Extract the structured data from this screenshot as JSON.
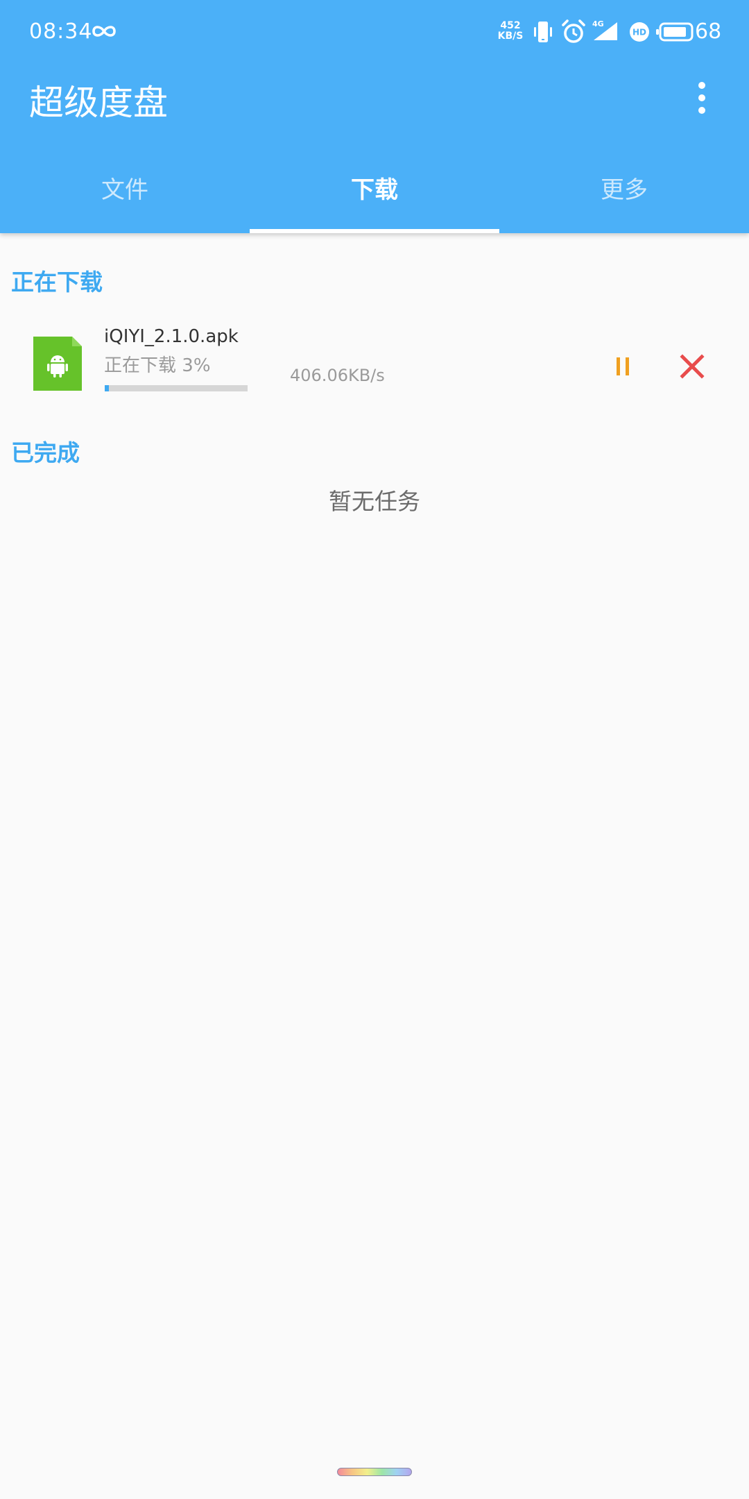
{
  "status_bar": {
    "time": "08:34",
    "net_speed_value": "452",
    "net_speed_unit": "KB/S",
    "network_type": "4G",
    "hd_label": "HD",
    "battery_level": "68"
  },
  "app_bar": {
    "title": "超级度盘"
  },
  "tabs": [
    {
      "label": "文件",
      "active": false
    },
    {
      "label": "下载",
      "active": true
    },
    {
      "label": "更多",
      "active": false
    }
  ],
  "downloading": {
    "section_title": "正在下载",
    "items": [
      {
        "file_name": "iQIYI_2.1.0.apk",
        "status": "正在下载",
        "percent_text": "3%",
        "progress": 0.03,
        "speed": "406.06KB/s",
        "icon": "android-apk-icon"
      }
    ]
  },
  "completed": {
    "section_title": "已完成",
    "empty_text": "暂无任务"
  },
  "colors": {
    "primary": "#4bb0f8",
    "accent": "#3ea9f1",
    "pause": "#f0a020",
    "cancel": "#e84c4c",
    "file_icon": "#66c22a"
  }
}
